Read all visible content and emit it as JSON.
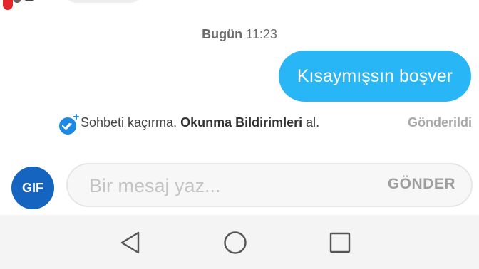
{
  "conversation": {
    "timestamp_day": "Bugün",
    "timestamp_time": "11:23",
    "outgoing_message": "Kısaymışsın boşver"
  },
  "read_receipts": {
    "text_prefix": "Sohbeti kaçırma.",
    "text_strong": "Okunma Bildirimleri",
    "text_suffix": "al.",
    "status": "Gönderildi"
  },
  "composer": {
    "gif_label": "GIF",
    "placeholder": "Bir mesaj yaz...",
    "send_label": "GÖNDER"
  },
  "navbar": {
    "icons": [
      "back-icon",
      "home-icon",
      "recent-apps-icon"
    ]
  },
  "colors": {
    "bubble_outgoing": "#29b6f6",
    "gif_button": "#1565c0",
    "receipt_check": "#1e88e5"
  }
}
